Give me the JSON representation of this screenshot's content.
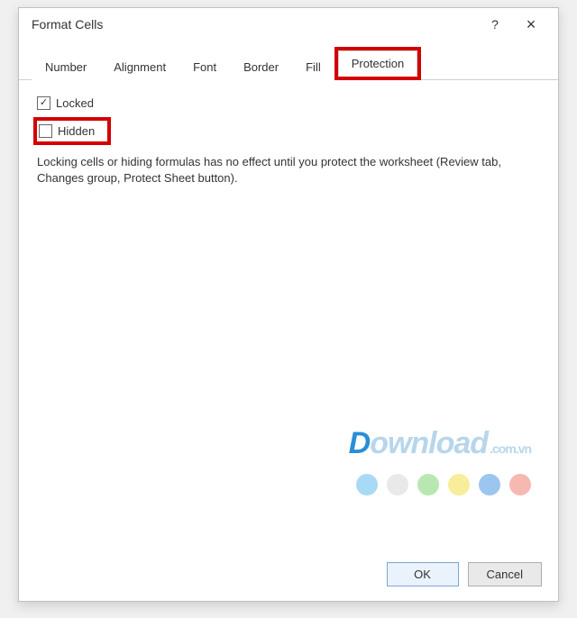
{
  "dialog": {
    "title": "Format Cells",
    "help_tooltip": "?",
    "close_tooltip": "×"
  },
  "tabs": {
    "number": "Number",
    "alignment": "Alignment",
    "font": "Font",
    "border": "Border",
    "fill": "Fill",
    "protection": "Protection"
  },
  "protection": {
    "locked_label": "Locked",
    "hidden_label": "Hidden",
    "locked_checked": true,
    "hidden_checked": false,
    "description": "Locking cells or hiding formulas has no effect until you protect the worksheet (Review tab, Changes group, Protect Sheet button)."
  },
  "buttons": {
    "ok": "OK",
    "cancel": "Cancel"
  },
  "watermark": {
    "prefix": "D",
    "rest": "ownload",
    "suffix": ".com.vn"
  },
  "dot_colors": [
    "#a9daf5",
    "#e9e9e9",
    "#b9e7b2",
    "#f8ed9a",
    "#9cc6ef",
    "#f6b9b1"
  ]
}
